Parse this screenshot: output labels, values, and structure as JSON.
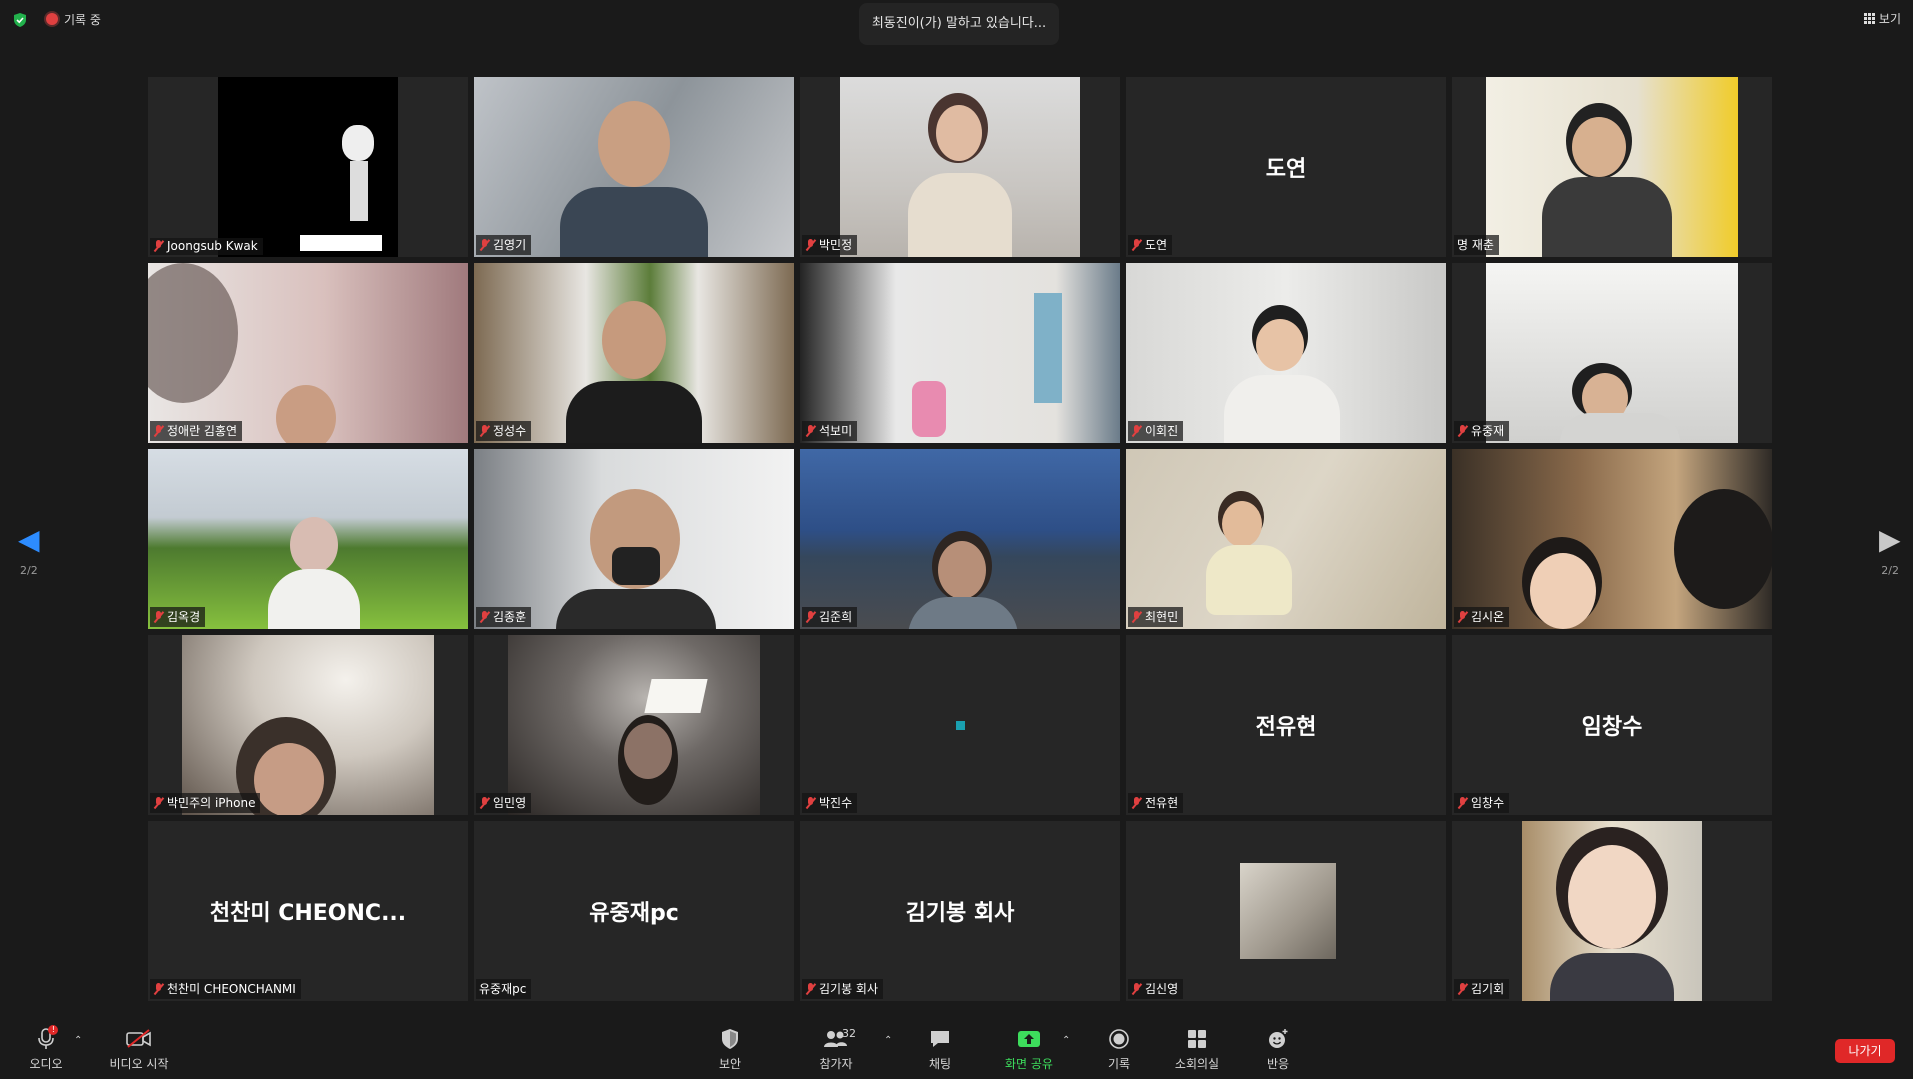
{
  "topbar": {
    "recording_label": "기록 중",
    "speaking_banner": "최동진이(가) 말하고 있습니다...",
    "view_label": "보기"
  },
  "pagination": {
    "left": "2/2",
    "right": "2/2"
  },
  "participants": [
    {
      "name": "Joongsub Kwak",
      "muted": true,
      "video": true
    },
    {
      "name": "김영기",
      "muted": true,
      "video": true
    },
    {
      "name": "박민정",
      "muted": true,
      "video": true
    },
    {
      "name": "도연",
      "muted": true,
      "video": false,
      "big_name": "도연"
    },
    {
      "name": "명 재춘",
      "muted": false,
      "video": true
    },
    {
      "name": "정애란 김홍연",
      "muted": true,
      "video": true
    },
    {
      "name": "정성수",
      "muted": true,
      "video": true
    },
    {
      "name": "석보미",
      "muted": true,
      "video": true
    },
    {
      "name": "이회진",
      "muted": true,
      "video": true
    },
    {
      "name": "유중재",
      "muted": true,
      "video": true
    },
    {
      "name": "김옥경",
      "muted": true,
      "video": true
    },
    {
      "name": "김종훈",
      "muted": true,
      "video": true
    },
    {
      "name": "김준희",
      "muted": true,
      "video": true
    },
    {
      "name": "최현민",
      "muted": true,
      "video": true
    },
    {
      "name": "김시온",
      "muted": true,
      "video": true
    },
    {
      "name": "박민주의 iPhone",
      "muted": true,
      "video": true
    },
    {
      "name": "임민영",
      "muted": true,
      "video": true
    },
    {
      "name": "박진수",
      "muted": true,
      "video": false,
      "big_name": ""
    },
    {
      "name": "전유현",
      "muted": true,
      "video": false,
      "big_name": "전유현"
    },
    {
      "name": "임창수",
      "muted": true,
      "video": false,
      "big_name": "임창수"
    },
    {
      "name": "천찬미 CHEONCHANMI",
      "muted": true,
      "video": false,
      "big_name": "천찬미 CHEONC..."
    },
    {
      "name": "유중재pc",
      "muted": false,
      "video": false,
      "big_name": "유중재pc"
    },
    {
      "name": "김기봉 회사",
      "muted": true,
      "video": false,
      "big_name": "김기봉 회사"
    },
    {
      "name": "김신영",
      "muted": true,
      "video": false,
      "big_name": ""
    },
    {
      "name": "김기회",
      "muted": true,
      "video": true
    }
  ],
  "toolbar": {
    "audio": "오디오",
    "audio_badge": "!",
    "video": "비디오 시작",
    "security": "보안",
    "participants": "참가자",
    "participants_count": "32",
    "chat": "채팅",
    "share": "화면 공유",
    "record": "기록",
    "breakout": "소회의실",
    "reactions": "반응",
    "leave": "나가기"
  },
  "colors": {
    "background": "#1a1a1a",
    "tile": "#262626",
    "muted_icon": "#e04040",
    "share_green": "#3ddc5c",
    "leave_red": "#e02828",
    "nav_blue": "#2d8cff"
  }
}
